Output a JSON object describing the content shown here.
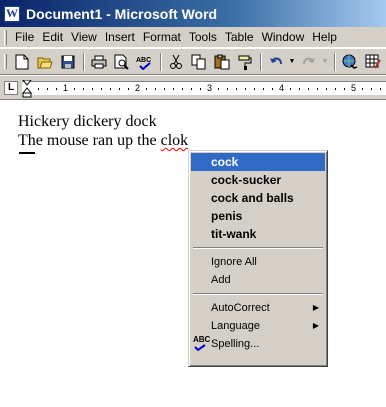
{
  "window": {
    "title": "Document1 - Microsoft Word",
    "icon_letter": "W"
  },
  "menubar": {
    "items": [
      {
        "label": "File",
        "name": "file"
      },
      {
        "label": "Edit",
        "name": "edit"
      },
      {
        "label": "View",
        "name": "view"
      },
      {
        "label": "Insert",
        "name": "insert"
      },
      {
        "label": "Format",
        "name": "format"
      },
      {
        "label": "Tools",
        "name": "tools"
      },
      {
        "label": "Table",
        "name": "table"
      },
      {
        "label": "Window",
        "name": "window"
      },
      {
        "label": "Help",
        "name": "help"
      }
    ]
  },
  "toolbar": {
    "icons": {
      "new": "new-document-icon",
      "open": "open-folder-icon",
      "save": "save-icon",
      "print": "print-icon",
      "print_preview": "print-preview-icon",
      "spelling": "spelling-check-icon",
      "cut": "cut-icon",
      "copy": "copy-icon",
      "paste": "paste-icon",
      "format_painter": "format-painter-icon",
      "undo": "undo-icon",
      "redo": "redo-icon",
      "hyperlink": "hyperlink-icon",
      "tables_borders": "tables-borders-icon"
    }
  },
  "ruler": {
    "tab_stop_glyph": "L",
    "labels": [
      "1",
      "2",
      "3",
      "4",
      "5"
    ]
  },
  "document": {
    "line1": "Hickery dickery dock",
    "line2_prefix": "The mouse ran up the ",
    "line2_misspelled": "clok"
  },
  "context_menu": {
    "suggestions": [
      "cock",
      "cock-sucker",
      "cock and balls",
      "penis",
      "tit-wank"
    ],
    "selected_index": 0,
    "ignore_all": "Ignore All",
    "add": "Add",
    "autocorrect": "AutoCorrect",
    "language": "Language",
    "spelling": "Spelling...",
    "spelling_icon_text": "ABC"
  },
  "colors": {
    "title_gradient_start": "#0a246a",
    "chrome": "#d4d0c8",
    "selection": "#316ac5",
    "misspelling_underline": "#ff0000"
  }
}
